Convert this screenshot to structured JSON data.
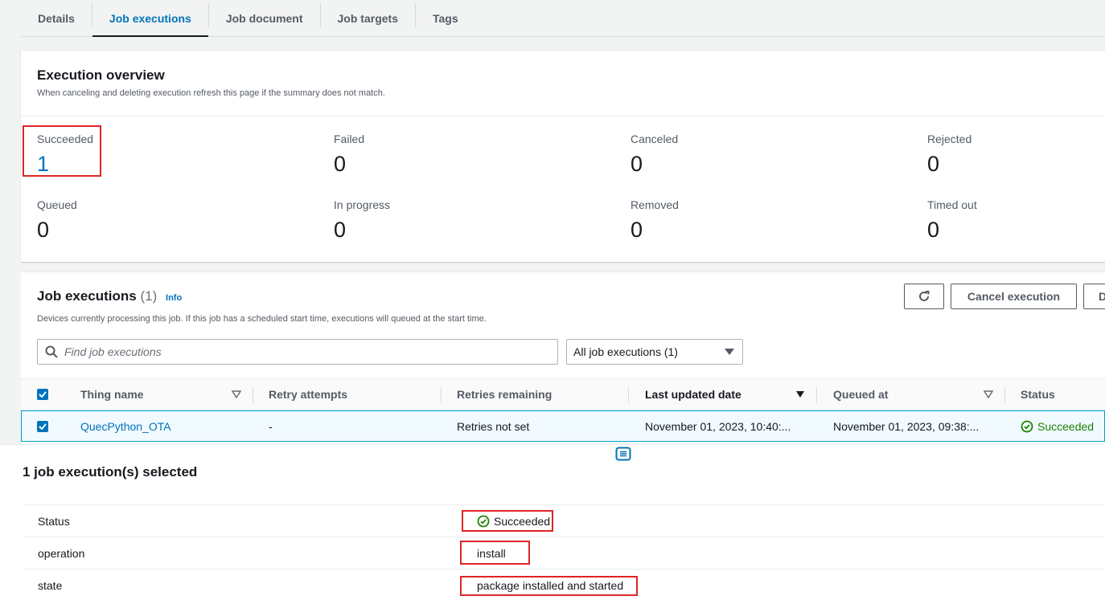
{
  "tabs": [
    {
      "label": "Details"
    },
    {
      "label": "Job executions"
    },
    {
      "label": "Job document"
    },
    {
      "label": "Job targets"
    },
    {
      "label": "Tags"
    }
  ],
  "overview": {
    "title": "Execution overview",
    "description": "When canceling and deleting execution refresh this page if the summary does not match.",
    "metrics": [
      {
        "label": "Succeeded",
        "value": "1"
      },
      {
        "label": "Failed",
        "value": "0"
      },
      {
        "label": "Canceled",
        "value": "0"
      },
      {
        "label": "Rejected",
        "value": "0"
      },
      {
        "label": "Queued",
        "value": "0"
      },
      {
        "label": "In progress",
        "value": "0"
      },
      {
        "label": "Removed",
        "value": "0"
      },
      {
        "label": "Timed out",
        "value": "0"
      }
    ]
  },
  "jobs": {
    "title": "Job executions",
    "count": "(1)",
    "info": "Info",
    "description": "Devices currently processing this job. If this job has a scheduled start time, executions will queued at the start time.",
    "cancel_label": "Cancel execution",
    "more_label": "D",
    "search_placeholder": "Find job executions",
    "filter_value": "All job executions (1)",
    "columns": [
      "Thing name",
      "Retry attempts",
      "Retries remaining",
      "Last updated date",
      "Queued at",
      "Status"
    ],
    "rows": [
      {
        "thing_name": "QuecPython_OTA",
        "retry_attempts": "-",
        "retries_remaining": "Retries not set",
        "last_updated": "November 01, 2023, 10:40:...",
        "queued_at": "November 01, 2023, 09:38:...",
        "status": "Succeeded"
      }
    ]
  },
  "selection": {
    "title": "1 job execution(s) selected",
    "details": [
      {
        "key": "Status",
        "value": "Succeeded"
      },
      {
        "key": "operation",
        "value": "install"
      },
      {
        "key": "state",
        "value": "package installed and started"
      }
    ]
  },
  "colors": {
    "accent": "#0073bb",
    "success": "#1d8102",
    "highlight": "#e02424"
  }
}
